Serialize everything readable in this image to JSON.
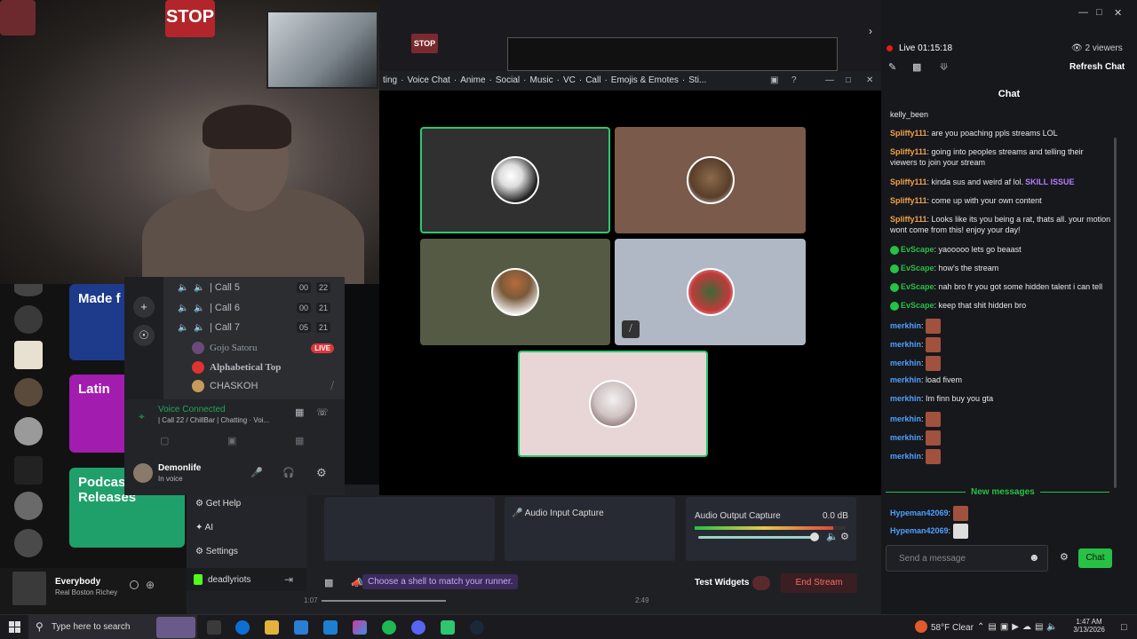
{
  "webcam": {
    "sign_text": "STOP"
  },
  "spotify": {
    "cards": [
      "Made f",
      "Latin",
      "Podcas\nReleases"
    ],
    "now_playing": {
      "title": "Everybody",
      "artist": "Real Boston Richey"
    }
  },
  "discord": {
    "channels": [
      {
        "name": "| Call 5",
        "a": "00",
        "b": "22"
      },
      {
        "name": "| Call 6",
        "a": "00",
        "b": "21"
      },
      {
        "name": "| Call 7",
        "a": "05",
        "b": "21"
      }
    ],
    "members": [
      {
        "name": "Gojo Satoru",
        "live": "LIVE"
      },
      {
        "name": "Alphabetical Top"
      },
      {
        "name": "CHASKOH"
      }
    ],
    "voice_status": "Voice Connected",
    "voice_channel": "| Call 22 / ChillBar | Chatting  · Voi...",
    "user_name": "Demonlife",
    "user_status": "In voice",
    "menu": [
      "Get Help",
      "AI",
      "Settings"
    ],
    "account": "deadlyriots"
  },
  "call": {
    "tabs": [
      "ting",
      "Voice Chat",
      "Anime",
      "Social",
      "Music",
      "VC",
      "Call",
      "Emojis & Emotes",
      "Sti..."
    ]
  },
  "obs": {
    "panels": [
      "Audio Output Capture",
      "Audio Input Capture"
    ],
    "audio_output": {
      "label": "Audio Output Capture",
      "db": "0.0 dB",
      "level": 0.92
    },
    "hint": "Choose a shell to match your runner.",
    "test_widgets": "Test Widgets",
    "end_stream": "End Stream",
    "seek_start": "1:07",
    "seek_end": "2:49"
  },
  "chat": {
    "live_label": "Live",
    "live_time": "01:15:18",
    "viewers": "2 viewers",
    "refresh": "Refresh Chat",
    "title": "Chat",
    "messages": [
      {
        "user": "",
        "text": "kelly_been"
      },
      {
        "user": "Spliffy111",
        "text": "are you poaching ppls streams LOL"
      },
      {
        "user": "Spliffy111",
        "text": "going into peoples streams and telling their viewers to join your stream"
      },
      {
        "user": "Spliffy111",
        "text": "kinda sus and weird af lol."
      },
      {
        "user": "Spliffy111",
        "text": "come up with your own content"
      },
      {
        "user": "Spliffy111",
        "text": "Looks like its you being a rat, thats all. your motion wont come from this! enjoy your day!"
      },
      {
        "user": "EvScape",
        "text": "yaooooo lets go beaast"
      },
      {
        "user": "EvScape",
        "text": "how's the stream"
      },
      {
        "user": "EvScape",
        "text": "nah bro fr you got some hidden talent i can tell"
      },
      {
        "user": "EvScape",
        "text": "keep that shit hidden bro"
      },
      {
        "user": "merkhin",
        "text": ""
      },
      {
        "user": "merkhin",
        "text": ""
      },
      {
        "user": "merkhin",
        "text": ""
      },
      {
        "user": "merkhin",
        "text": "load fivem"
      },
      {
        "user": "merkhin",
        "text": "Im finn buy you gta"
      },
      {
        "user": "merkhin",
        "text": ""
      },
      {
        "user": "merkhin",
        "text": ""
      },
      {
        "user": "merkhin",
        "text": ""
      }
    ],
    "new_messages": "New messages",
    "new": [
      {
        "user": "Hypeman42069",
        "text": ""
      },
      {
        "user": "Hypeman42069",
        "text": ""
      }
    ],
    "input_placeholder": "Send a message",
    "send": "Chat",
    "skill_emote": "SKILL ISSUE"
  },
  "taskbar": {
    "search_placeholder": "Type here to search",
    "weather": "58°F  Clear",
    "time": "1:47 AM",
    "date": "3/13/2026"
  },
  "colors": {
    "accent": "#26c145",
    "live": "#e91916",
    "discord_bg": "#2b2d31"
  }
}
